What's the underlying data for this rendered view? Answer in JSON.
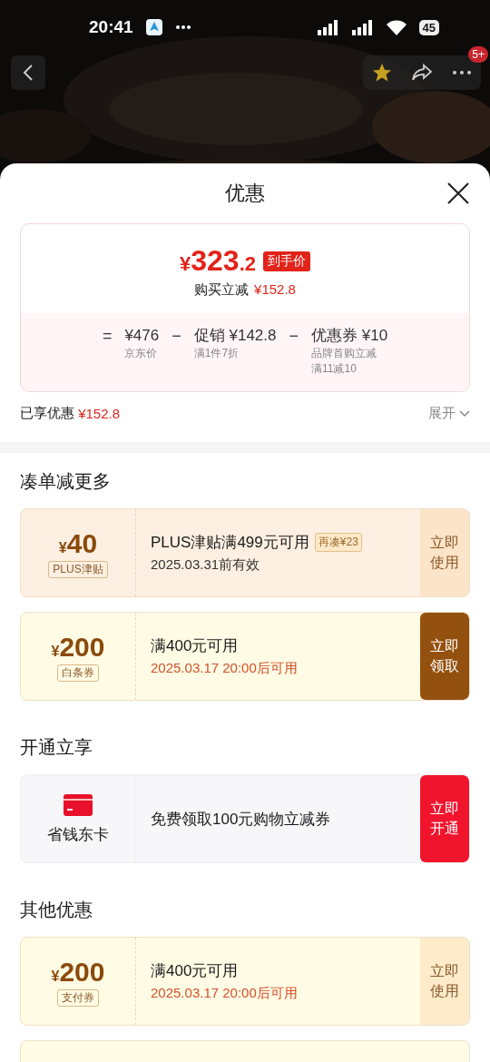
{
  "status_bar": {
    "time": "20:41",
    "battery": "45"
  },
  "nav": {
    "badge": "5+"
  },
  "sheet": {
    "title": "优惠",
    "price": {
      "symbol": "¥",
      "integer": "323",
      "decimal": ".2",
      "badge": "到手价",
      "saving_label": "购买立减",
      "saving_value": "¥152.8",
      "breakdown": [
        {
          "op": "=",
          "value": "¥476",
          "notes": [
            "京东价"
          ]
        },
        {
          "op": "−",
          "label": "促销",
          "value": "¥142.8",
          "notes": [
            "满1件7折"
          ]
        },
        {
          "op": "−",
          "label": "优惠券",
          "value": "¥10",
          "notes": [
            "品牌首购立减",
            "满11减10"
          ]
        }
      ]
    },
    "enjoyed": {
      "label": "已享优惠",
      "value": "¥152.8",
      "expand": "展开"
    },
    "sections": [
      {
        "title": "凑单减更多",
        "items": [
          {
            "kind": "coupon",
            "color": "#fdefe1",
            "symbol": "¥",
            "amount": "40",
            "tag": "PLUS津贴",
            "title": "PLUS津贴满499元可用",
            "extra": "再凑¥23",
            "subtitle": "2025.03.31前有效",
            "highlight": false,
            "action": [
              "立即",
              "使用"
            ],
            "filled": false
          },
          {
            "kind": "coupon",
            "color": "#fffbe4",
            "symbol": "¥",
            "amount": "200",
            "tag": "白条券",
            "title": "满400元可用",
            "subtitle": "2025.03.17 20:00后可用",
            "highlight": true,
            "action": [
              "立即",
              "领取"
            ],
            "filled": true
          }
        ]
      },
      {
        "title": "开通立享",
        "items": [
          {
            "kind": "membership",
            "name": "省钱东卡",
            "title": "免费领取100元购物立减券",
            "action": [
              "立即",
              "开通"
            ],
            "filled": true
          }
        ]
      },
      {
        "title": "其他优惠",
        "items": [
          {
            "kind": "coupon",
            "color": "#fffbe4",
            "symbol": "¥",
            "amount": "200",
            "tag": "支付券",
            "title": "满400元可用",
            "subtitle": "2025.03.17 20:00后可用",
            "highlight": true,
            "action": [
              "立即",
              "使用"
            ],
            "filled": false
          }
        ]
      }
    ]
  }
}
